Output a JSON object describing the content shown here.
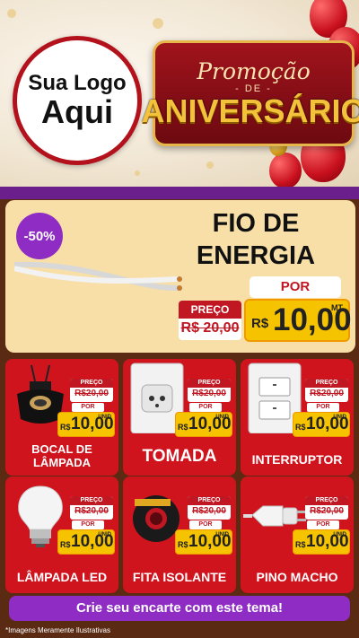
{
  "header": {
    "logo": {
      "line1": "Sua Logo",
      "line2": "Aqui"
    },
    "promo": {
      "title": "Promoção",
      "middle": "- DE -",
      "big": "ANIVERSÁRIO"
    }
  },
  "featured": {
    "discount": "-50%",
    "name_line1": "FIO DE",
    "name_line2": "ENERGIA",
    "por_label": "POR",
    "preco_label": "PREÇO",
    "old_price": "R$ 20,00",
    "currency": "R$",
    "price": "10,00",
    "unit": "MT"
  },
  "products": [
    {
      "name": "BOCAL DE LÂMPADA",
      "icon": "lamp-socket-icon",
      "preco_label": "PREÇO",
      "old_price": "R$20,00",
      "por_label": "POR",
      "currency": "R$",
      "price": "10,00",
      "unit": "UNID"
    },
    {
      "name": "TOMADA",
      "icon": "outlet-icon",
      "preco_label": "PREÇO",
      "old_price": "R$20,00",
      "por_label": "POR",
      "currency": "R$",
      "price": "10,00",
      "unit": "UNID"
    },
    {
      "name": "INTERRUPTOR",
      "icon": "light-switch-icon",
      "preco_label": "PREÇO",
      "old_price": "R$20,00",
      "por_label": "POR",
      "currency": "R$",
      "price": "10,00",
      "unit": "UNID"
    },
    {
      "name": "LÂMPADA LED",
      "icon": "led-bulb-icon",
      "preco_label": "PREÇO",
      "old_price": "R$20,00",
      "por_label": "POR",
      "currency": "R$",
      "price": "10,00",
      "unit": "UNID"
    },
    {
      "name": "FITA ISOLANTE",
      "icon": "insulating-tape-icon",
      "preco_label": "PREÇO",
      "old_price": "R$20,00",
      "por_label": "POR",
      "currency": "R$",
      "price": "10,00",
      "unit": "UNID"
    },
    {
      "name": "PINO MACHO",
      "icon": "plug-icon",
      "preco_label": "PREÇO",
      "old_price": "R$20,00",
      "por_label": "POR",
      "currency": "R$",
      "price": "10,00",
      "unit": "UNID"
    }
  ],
  "cta": "Crie seu encarte com este tema!",
  "footnote": "*Imagens Meramente Ilustrativas",
  "colors": {
    "red": "#d0141e",
    "purple": "#8e2cc4",
    "yellow": "#f5c300",
    "cream": "#f7dfa7",
    "brown": "#5a2a12"
  }
}
